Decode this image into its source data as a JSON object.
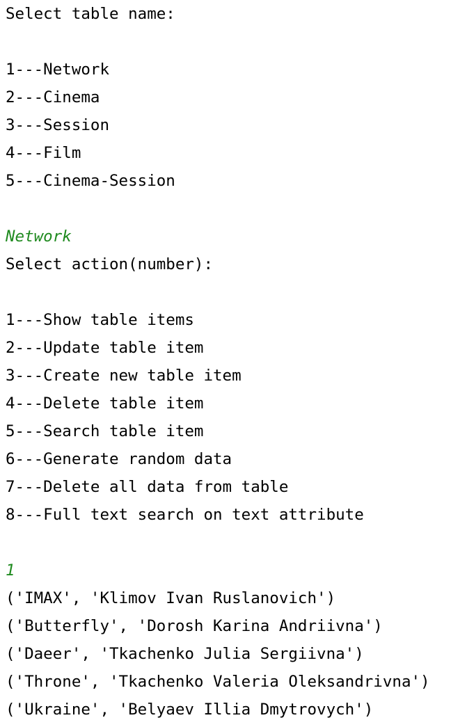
{
  "colors": {
    "text": "#000000",
    "user_input": "#1f8a1f",
    "background": "#ffffff"
  },
  "table_menu": {
    "prompt": "Select table name:",
    "options": [
      "1---Network",
      "2---Cinema",
      "3---Session",
      "4---Film",
      "5---Cinema-Session"
    ]
  },
  "table_choice_echo": "Network",
  "action_menu": {
    "prompt": "Select action(number):",
    "options": [
      "1---Show table items",
      "2---Update table item",
      "3---Create new table item",
      "4---Delete table item",
      "5---Search table item",
      "6---Generate random data",
      "7---Delete all data from table",
      "8---Full text search on text attribute"
    ]
  },
  "action_choice_echo": "1",
  "results": [
    "('IMAX', 'Klimov Ivan Ruslanovich')",
    "('Butterfly', 'Dorosh Karina Andriivna')",
    "('Daeer', 'Tkachenko Julia Sergiivna')",
    "('Throne', 'Tkachenko Valeria Oleksandrivna')",
    "('Ukraine', 'Belyaev Illia Dmytrovych')"
  ]
}
